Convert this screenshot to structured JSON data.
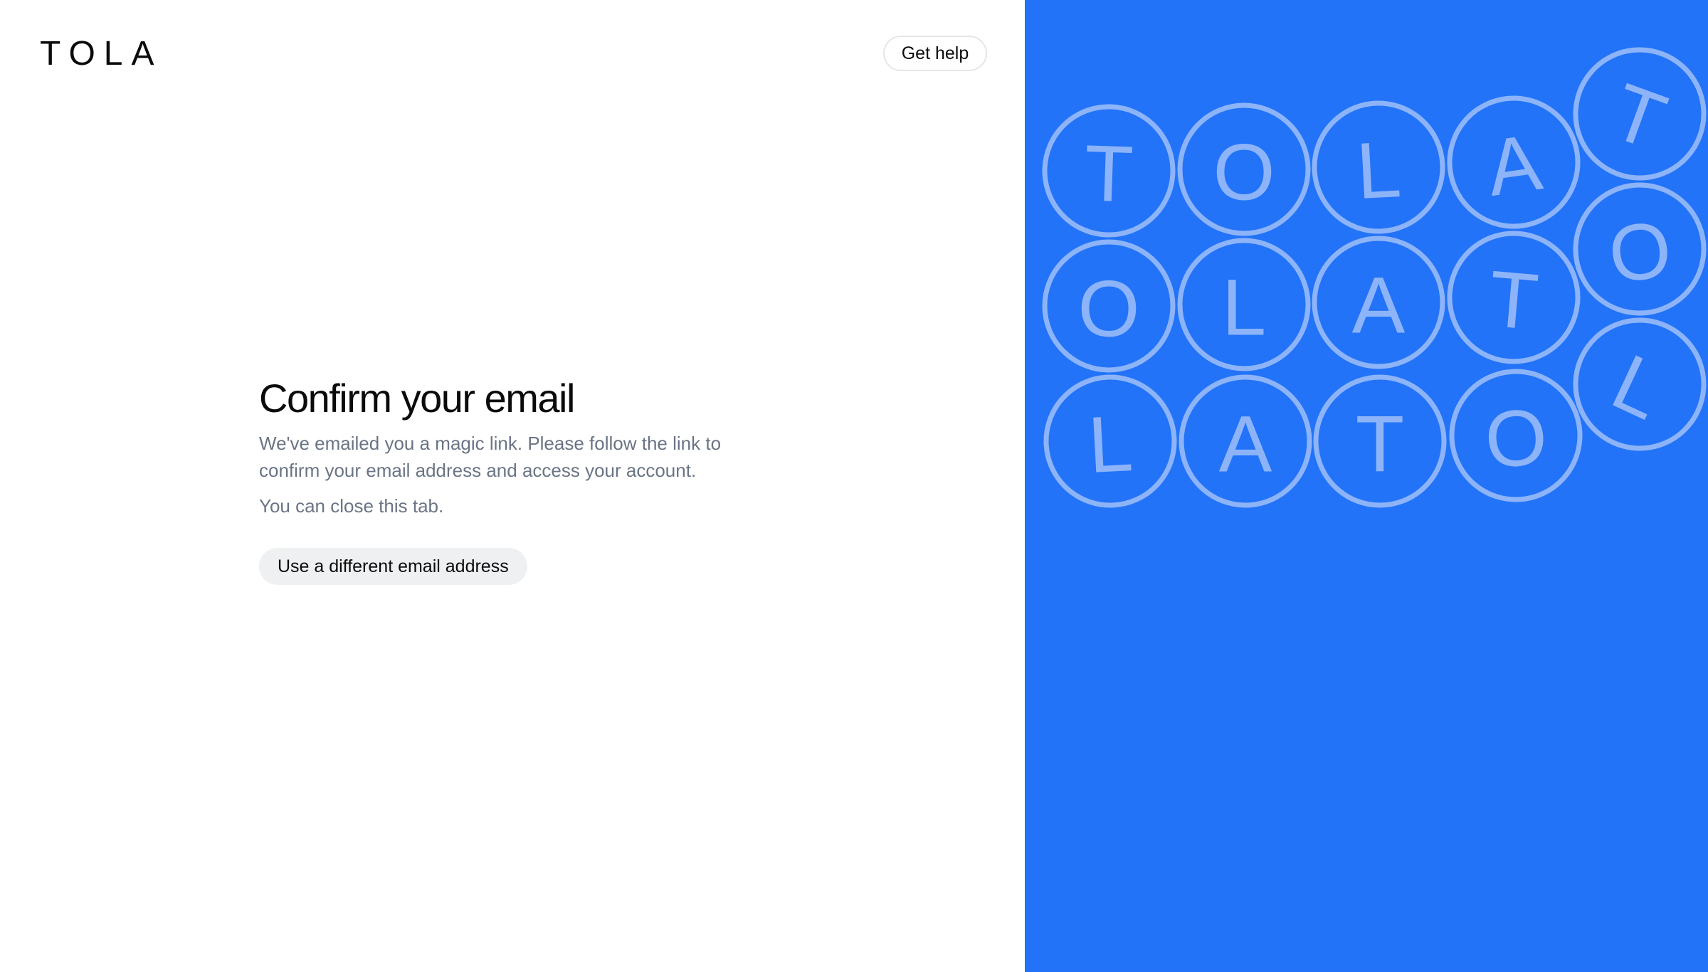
{
  "header": {
    "logo_text": "TOLA",
    "help_label": "Get help"
  },
  "main": {
    "title": "Confirm your email",
    "description": "We've emailed you a magic link. Please follow the link to confirm your email address and access your account.",
    "close_note": "You can close this tab.",
    "alt_email_label": "Use a different email address"
  },
  "decor": {
    "background_color": "#2273f7",
    "tile_color": "#8db4f9",
    "rows": [
      [
        "T",
        "O",
        "L",
        "A",
        "T"
      ],
      [
        "O",
        "L",
        "A",
        "T",
        "O"
      ],
      [
        "L",
        "A",
        "T",
        "O",
        "L"
      ]
    ]
  }
}
